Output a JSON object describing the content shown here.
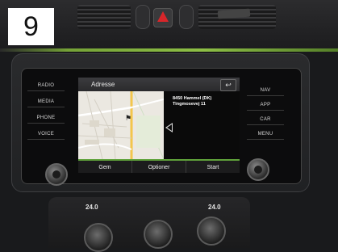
{
  "step_label": "9",
  "left_buttons": [
    "RADIO",
    "MEDIA",
    "PHONE",
    "VOICE"
  ],
  "right_buttons": [
    "NAV",
    "APP",
    "CAR",
    "MENU"
  ],
  "screen": {
    "title": "Adresse",
    "back_symbol": "↩",
    "address_line1": "8450 Hammel (DK)",
    "address_line2": "Tingmosevej 11",
    "softkeys": [
      "Gem",
      "Optioner",
      "Start"
    ]
  },
  "climate": {
    "left_temp": "24.0",
    "right_temp": "24.0"
  },
  "colors": {
    "accent_green": "#5fa23a",
    "hazard_red": "#d8262a"
  }
}
